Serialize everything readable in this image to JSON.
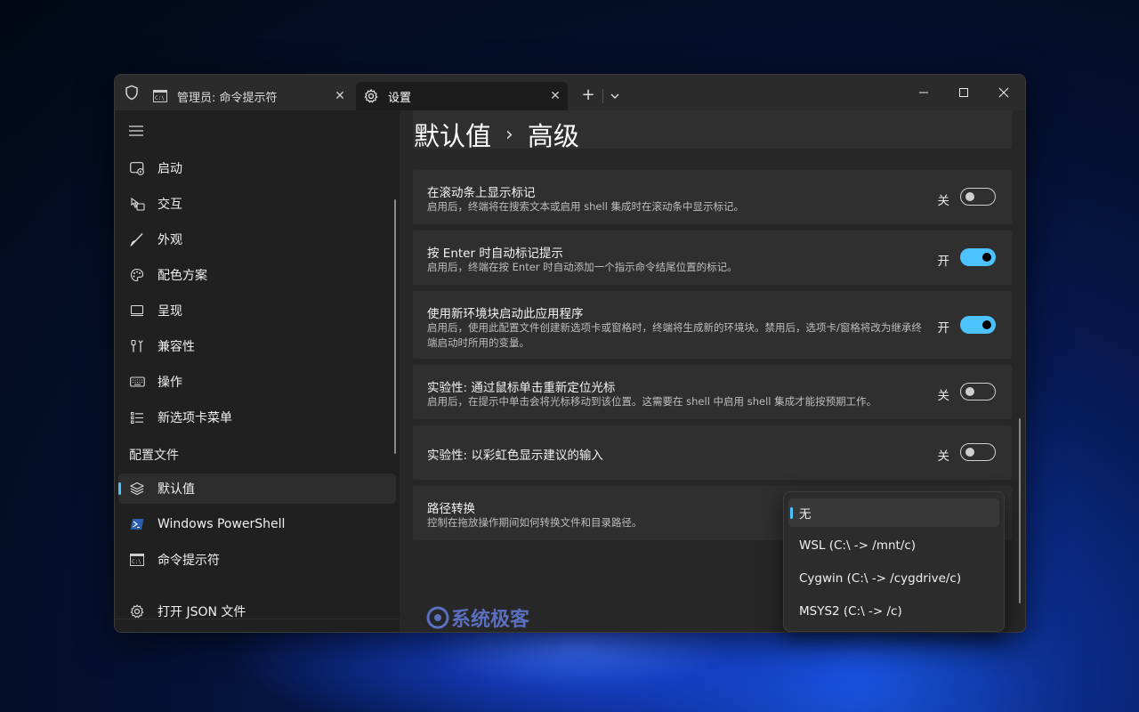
{
  "window": {
    "tabs": [
      {
        "label": "管理员: 命令提示符",
        "close": "✕"
      },
      {
        "label": "设置",
        "close": "✕"
      }
    ],
    "new_tab": "+"
  },
  "sidebar": {
    "items": [
      {
        "label": "启动",
        "icon": "launch-icon"
      },
      {
        "label": "交互",
        "icon": "interaction-icon"
      },
      {
        "label": "外观",
        "icon": "brush-icon"
      },
      {
        "label": "配色方案",
        "icon": "palette-icon"
      },
      {
        "label": "呈现",
        "icon": "display-icon"
      },
      {
        "label": "兼容性",
        "icon": "tools-icon"
      },
      {
        "label": "操作",
        "icon": "keyboard-icon"
      },
      {
        "label": "新选项卡菜单",
        "icon": "list-icon"
      }
    ],
    "profiles_header": "配置文件",
    "profiles": [
      {
        "label": "默认值",
        "icon": "layers-icon",
        "selected": true
      },
      {
        "label": "Windows PowerShell",
        "icon": "powershell-icon"
      },
      {
        "label": "命令提示符",
        "icon": "cmd-icon"
      }
    ],
    "footer_label": "打开 JSON 文件"
  },
  "page": {
    "breadcrumb_parent": "默认值",
    "breadcrumb_sep": "›",
    "breadcrumb_current": "高级"
  },
  "settings": [
    {
      "title": "在滚动条上显示标记",
      "desc": "启用后，终端将在搜索文本或启用 shell 集成时在滚动条中显示标记。",
      "state": "关",
      "on": false
    },
    {
      "title": "按 Enter 时自动标记提示",
      "desc": "启用后，终端在按 Enter 时自动添加一个指示命令结尾位置的标记。",
      "state": "开",
      "on": true
    },
    {
      "title": "使用新环境块启动此应用程序",
      "desc": "启用后，使用此配置文件创建新选项卡或窗格时，终端将生成新的环境块。禁用后，选项卡/窗格将改为继承终端启动时所用的变量。",
      "state": "开",
      "on": true
    },
    {
      "title": "实验性: 通过鼠标单击重新定位光标",
      "desc": "启用后，在提示中单击会将光标移动到该位置。这需要在 shell 中启用 shell 集成才能按预期工作。",
      "state": "关",
      "on": false
    },
    {
      "title": "实验性: 以彩虹色显示建议的输入",
      "desc": "",
      "state": "关",
      "on": false
    },
    {
      "title": "路径转换",
      "desc": "控制在拖放操作期间如何转换文件和目录路径。"
    }
  ],
  "dropdown": {
    "options": [
      "无",
      "WSL (C:\\ -> /mnt/c)",
      "Cygwin (C:\\ -> /cygdrive/c)",
      "MSYS2 (C:\\ -> /c)"
    ],
    "selected": "无"
  },
  "watermark": "系统极客",
  "colors": {
    "accent": "#4cc2ff",
    "window_bg": "#202020",
    "card_bg": "#2f2f2f"
  }
}
